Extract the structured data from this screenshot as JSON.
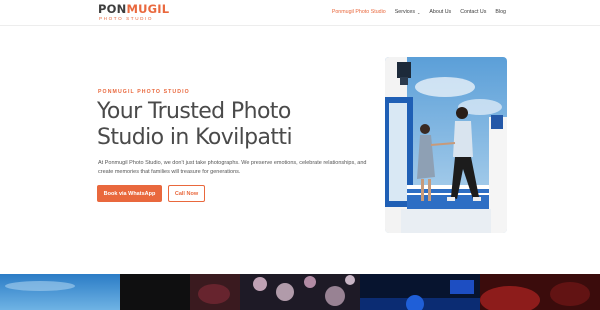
{
  "brand": {
    "name_part1": "PON",
    "name_part2": "MUGIL",
    "tagline": "PHOTO STUDIO"
  },
  "nav": {
    "items": [
      {
        "label": "Ponmugil Photo Studio",
        "active": true
      },
      {
        "label": "Services",
        "has_dropdown": true
      },
      {
        "label": "About Us"
      },
      {
        "label": "Contact Us"
      },
      {
        "label": "Blog"
      }
    ]
  },
  "hero": {
    "eyebrow": "PONMUGIL PHOTO STUDIO",
    "title": "Your Trusted Photo Studio in Kovilpatti",
    "description": "At Ponmugil Photo Studio, we don't just take photographs. We preserve emotions, celebrate relationships, and create memories that families will treasure for generations.",
    "primary_button": "Book via WhatsApp",
    "secondary_button": "Call Now"
  },
  "colors": {
    "accent": "#e9683d",
    "text": "#4a4a4a"
  }
}
